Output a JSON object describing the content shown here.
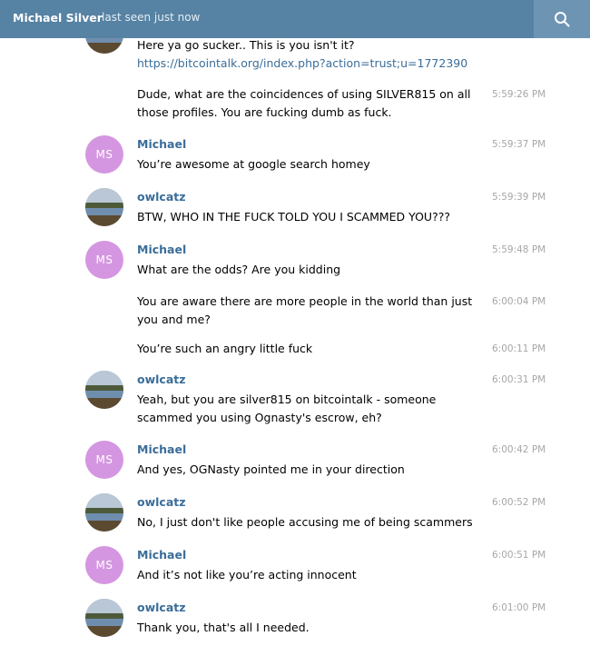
{
  "header": {
    "contact_name": "Michael Silver",
    "status": "last seen just now",
    "search_icon": "search-icon"
  },
  "messages": [
    {
      "author": "",
      "avatar": "owl",
      "lines": [
        "Here ya go sucker.. This is you isn't it?"
      ],
      "link": "https://bitcointalk.org/index.php?action=trust;u=1772390",
      "time": ""
    },
    {
      "author": "",
      "avatar": "",
      "text": "Dude, what are the coincidences of using SILVER815 on all those profiles. You are fucking dumb as fuck.",
      "time": "5:59:26 PM"
    },
    {
      "author": "Michael",
      "avatar": "MS",
      "text": "You’re awesome at google search homey",
      "time": "5:59:37 PM"
    },
    {
      "author": "owlcatz",
      "avatar": "owl",
      "text": "BTW, WHO IN THE FUCK TOLD YOU I SCAMMED YOU???",
      "time": "5:59:39 PM"
    },
    {
      "author": "Michael",
      "avatar": "MS",
      "text": "What are the odds? Are you kidding",
      "time": "5:59:48 PM"
    },
    {
      "author": "",
      "avatar": "",
      "text": "You are aware there are more people in the world than just you and me?",
      "time": "6:00:04 PM"
    },
    {
      "author": "",
      "avatar": "",
      "text": "You’re such an angry little fuck",
      "time": "6:00:11 PM"
    },
    {
      "author": "owlcatz",
      "avatar": "owl",
      "text": "Yeah, but you are silver815 on bitcointalk - someone scammed you using Ognasty's escrow, eh?",
      "time": "6:00:31 PM"
    },
    {
      "author": "Michael",
      "avatar": "MS",
      "text": "And yes, OGNasty pointed me in your direction",
      "time": "6:00:42 PM"
    },
    {
      "author": "owlcatz",
      "avatar": "owl",
      "text": "No, I just don't like people accusing me of being scammers",
      "time": "6:00:52 PM"
    },
    {
      "author": "Michael",
      "avatar": "MS",
      "text": "And it’s not like you’re acting innocent",
      "time": "6:00:51 PM"
    },
    {
      "author": "owlcatz",
      "avatar": "owl",
      "text": "Thank you, that's all I needed.",
      "time": "6:01:00 PM"
    }
  ],
  "colors": {
    "header_bg": "#5682a3",
    "search_bg": "#6e94b4",
    "author": "#3a6d99",
    "time": "#a7a7a7",
    "ms_avatar": "#d596e1"
  }
}
